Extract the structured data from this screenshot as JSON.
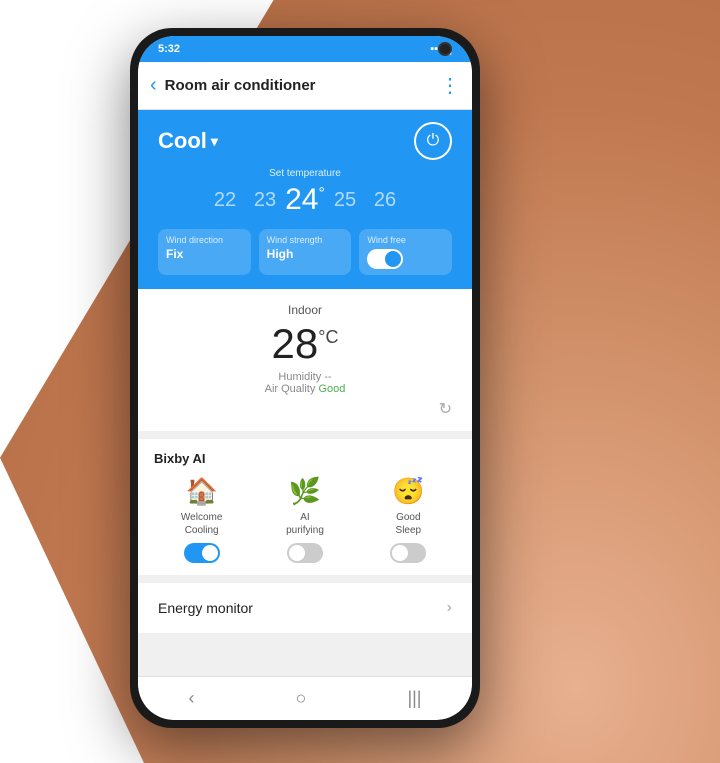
{
  "status_bar": {
    "time": "5:32",
    "signal_icon": "signal-icon",
    "wifi_icon": "wifi-icon",
    "battery_icon": "battery-icon"
  },
  "header": {
    "back_label": "‹",
    "title": "Room air conditioner",
    "more_icon": "⋮"
  },
  "ac_control": {
    "mode": "Cool",
    "mode_arrow": "▾",
    "set_temp_label": "Set temperature",
    "temperatures": [
      "22",
      "23",
      "24",
      "25",
      "26"
    ],
    "active_temp": "24",
    "active_index": 2,
    "degree_symbol": "°",
    "wind_direction_label": "Wind direction",
    "wind_direction_value": "Fix",
    "wind_strength_label": "Wind strength",
    "wind_strength_value": "High",
    "wind_free_label": "Wind free",
    "power_icon": "⏻"
  },
  "indoor": {
    "title": "Indoor",
    "temperature": "28",
    "unit": "°C",
    "humidity_label": "Humidity --",
    "air_quality_label": "Air Quality",
    "air_quality_value": "Good"
  },
  "bixby": {
    "title": "Bixby AI",
    "items": [
      {
        "id": "welcome-cooling",
        "icon": "🏠",
        "label": "Welcome\nCooling",
        "state": "on"
      },
      {
        "id": "ai-purifying",
        "icon": "🌿",
        "label": "AI\npurifying",
        "state": "off"
      },
      {
        "id": "good-sleep",
        "icon": "😴",
        "label": "Good\nSleep",
        "state": "off"
      }
    ]
  },
  "energy_monitor": {
    "label": "Energy monitor",
    "chevron": "›"
  },
  "nav_bar": {
    "back_icon": "‹",
    "home_icon": "○",
    "recents_icon": "|||"
  }
}
